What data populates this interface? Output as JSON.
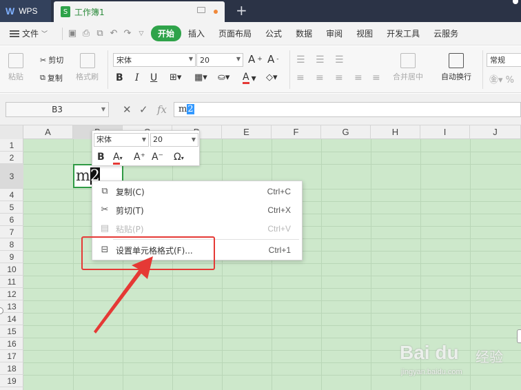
{
  "tabs": {
    "app": "WPS",
    "book": "工作簿1"
  },
  "menubar": {
    "file": "文件",
    "items": [
      "开始",
      "插入",
      "页面布局",
      "公式",
      "数据",
      "审阅",
      "视图",
      "开发工具",
      "云服务"
    ],
    "active_index": 0
  },
  "ribbon": {
    "paste": "粘贴",
    "cut": "剪切",
    "copy": "复制",
    "format_painter": "格式刷",
    "font_name": "宋体",
    "font_size": "20",
    "merge_center": "合并居中",
    "wrap_text": "自动换行",
    "number_format": "常规"
  },
  "formula": {
    "cell_ref": "B3",
    "fx": "fx",
    "text_plain": "m",
    "text_selected": "2"
  },
  "grid": {
    "columns": [
      "A",
      "B",
      "C",
      "D",
      "E",
      "F",
      "G",
      "H",
      "I",
      "J"
    ],
    "rows": [
      "1",
      "2",
      "3",
      "4",
      "5",
      "6",
      "7",
      "8",
      "9",
      "10",
      "11",
      "12",
      "13",
      "14",
      "15",
      "16",
      "17",
      "18",
      "19"
    ],
    "active_col": "B",
    "active_row": "3",
    "cell_text_plain": "m",
    "cell_text_selected": "2"
  },
  "minibar": {
    "font_name": "宋体",
    "font_size": "20",
    "bold": "B",
    "font_color": "A",
    "grow": "A⁺",
    "shrink": "A⁻",
    "symbol": "Ω"
  },
  "context_menu": {
    "items": [
      {
        "label": "复制(C)",
        "shortcut": "Ctrl+C",
        "icon": "copy-icon",
        "enabled": true
      },
      {
        "label": "剪切(T)",
        "shortcut": "Ctrl+X",
        "icon": "scissors-icon",
        "enabled": true
      },
      {
        "label": "粘贴(P)",
        "shortcut": "Ctrl+V",
        "icon": "paste-icon",
        "enabled": false
      },
      {
        "label": "设置单元格格式(F)...",
        "shortcut": "Ctrl+1",
        "icon": "format-cells-icon",
        "enabled": true
      }
    ]
  },
  "watermark": {
    "brand": "Bai du",
    "cn": "经验",
    "url": "jingyan.baidu.com"
  },
  "colors": {
    "accent": "#2fa34a",
    "grid_bg": "#cde8cb",
    "annotation": "#e53935"
  }
}
